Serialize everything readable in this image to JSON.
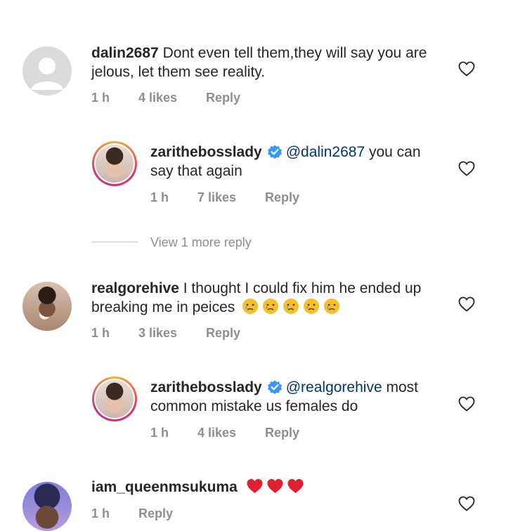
{
  "comments": [
    {
      "username": "dalin2687",
      "text": "Dont even tell them,they will say you are jelous, let them see reality.",
      "time": "1 h",
      "likes": "4 likes",
      "reply": "Reply"
    },
    {
      "username": "zarithebosslady",
      "mention": "@dalin2687",
      "text": "you can say that again",
      "time": "1 h",
      "likes": "7 likes",
      "reply": "Reply"
    },
    {
      "username": "realgorehive",
      "text": "I thought I could fix him he ended up breaking me in peices",
      "time": "1 h",
      "likes": "3 likes",
      "reply": "Reply"
    },
    {
      "username": "zarithebosslady",
      "mention": "@realgorehive",
      "text": "most common mistake us females do",
      "time": "1 h",
      "likes": "4 likes",
      "reply": "Reply"
    },
    {
      "username": "iam_queenmsukuma",
      "time": "1 h",
      "reply": "Reply"
    }
  ],
  "view_more": "View 1 more reply",
  "icons": {
    "like": "heart-outline-icon",
    "verified": "verified-badge-icon",
    "crying_emoji": "crying-face-emoji",
    "red_heart": "red-heart-emoji"
  },
  "colors": {
    "mention": "#00376b",
    "meta": "#8e8e8e",
    "verified": "#3897f0",
    "red_heart": "#e0202f",
    "emoji": "#f6c02c"
  }
}
